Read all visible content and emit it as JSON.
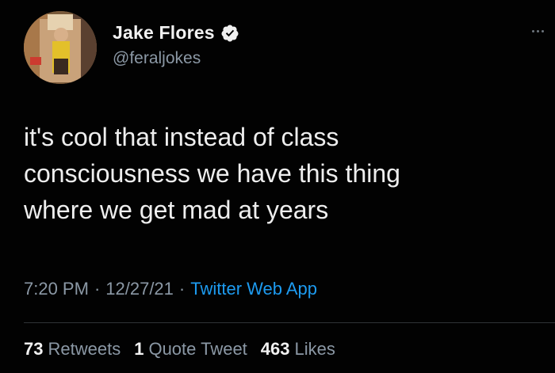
{
  "author": {
    "display_name": "Jake Flores",
    "handle": "@feraljokes",
    "verified": true,
    "avatar_icon": "profile-photo"
  },
  "tweet": {
    "text": "it's cool that instead of class\nconsciousness we have this thing\nwhere we get mad at years",
    "time": "7:20 PM",
    "date": "12/27/21",
    "separator": "·",
    "source": "Twitter Web App"
  },
  "stats": {
    "retweets_count": "73",
    "retweets_label": "Retweets",
    "quote_count": "1",
    "quote_label": "Quote Tweet",
    "likes_count": "463",
    "likes_label": "Likes"
  },
  "colors": {
    "background": "#000000",
    "verified_blue": "#1d9bf0",
    "link_blue": "#1d9bf0",
    "secondary_text": "#8b98a5"
  }
}
